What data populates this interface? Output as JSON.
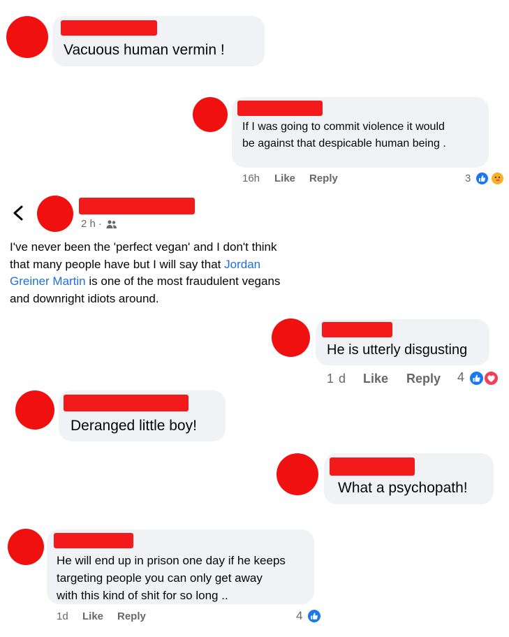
{
  "comments": [
    {
      "text": "Vacuous  human vermin !"
    },
    {
      "text": "If I was going to commit violence it would\nbe against that despicable human being .",
      "time": "16h",
      "like": "Like",
      "reply": "Reply",
      "reaction_count": "3",
      "reactions": [
        "like-icon",
        "care-icon"
      ]
    },
    {
      "time": "2 h ·",
      "text_part1": "I've never been the 'perfect vegan' and I don't think\nthat many people have but I will say that ",
      "link": "Jordan\nGreiner Martin",
      "text_part2": " is one of the most fraudulent vegans\nand downright idiots around."
    },
    {
      "text": "He is utterly disgusting",
      "time": "1 d",
      "like": "Like",
      "reply": "Reply",
      "reaction_count": "4",
      "reactions": [
        "like-icon",
        "love-icon"
      ]
    },
    {
      "text": "Deranged little boy!"
    },
    {
      "text": "What a psychopath!"
    },
    {
      "text": "He will end up in prison one day if he keeps\ntargeting people you can only get away\nwith this kind of shit for so long ..",
      "time": "1d",
      "like": "Like",
      "reply": "Reply",
      "reaction_count": "4",
      "reactions": [
        "like-icon"
      ]
    }
  ],
  "colors": {
    "redaction": "#f01010",
    "bubble": "#f0f2f5",
    "link": "#216fdb",
    "like": "#1877f2",
    "love": "#f33e58"
  }
}
